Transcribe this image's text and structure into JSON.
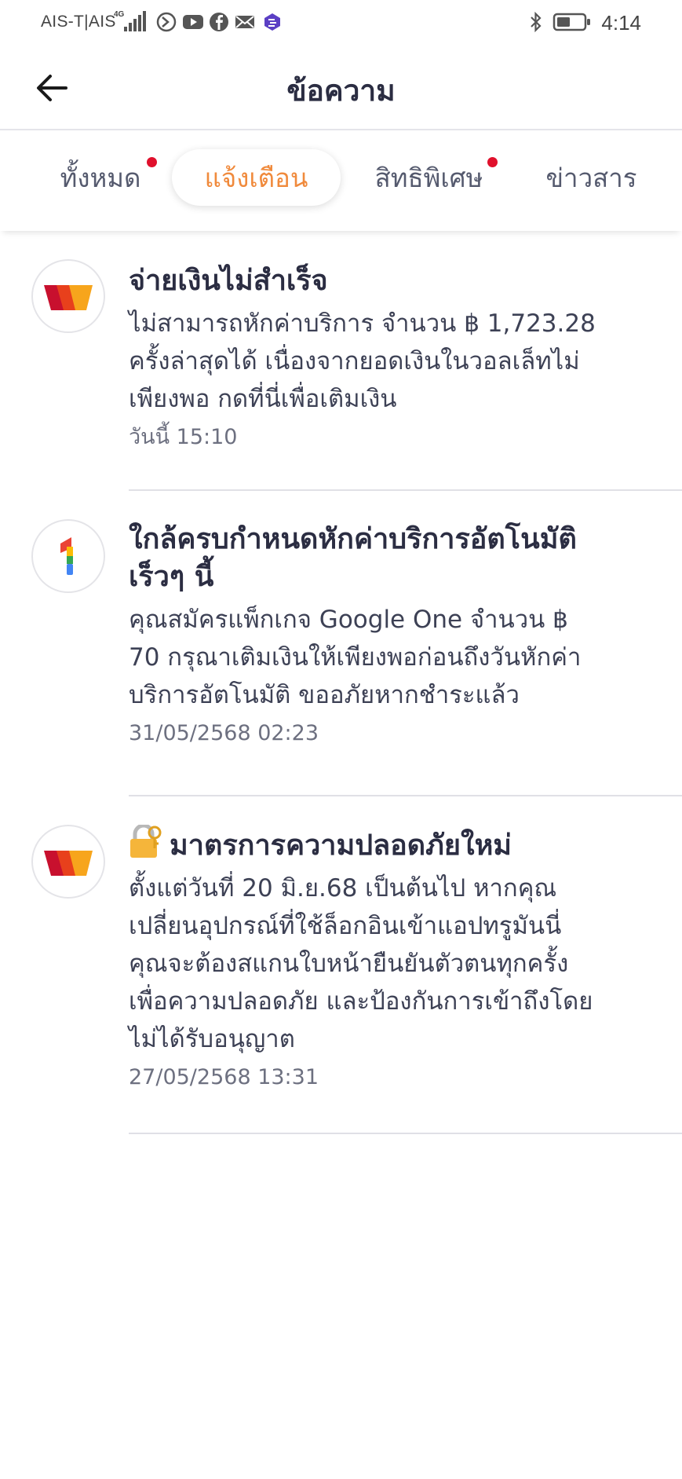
{
  "status_bar": {
    "carrier": "AIS-T|AIS",
    "network": "4G",
    "time": "4:14",
    "icons": [
      "signal-icon",
      "vpn-icon",
      "youtube-icon",
      "facebook-icon",
      "mail-icon",
      "app-icon",
      "bluetooth-icon",
      "battery-icon"
    ]
  },
  "header": {
    "title": "ข้อความ",
    "back_icon": "arrow-left-icon"
  },
  "tabs": [
    {
      "label": "ทั้งหมด",
      "active": false,
      "has_dot": true
    },
    {
      "label": "แจ้งเตือน",
      "active": true,
      "has_dot": false
    },
    {
      "label": "สิทธิพิเศษ",
      "active": false,
      "has_dot": true
    },
    {
      "label": "ข่าวสาร",
      "active": false,
      "has_dot": false
    }
  ],
  "notifications": [
    {
      "icon": "truemoney-wallet-icon",
      "title": "จ่ายเงินไม่สำเร็จ",
      "text_lines": [
        "ไม่สามารถหักค่าบริการ จำนวน ฿ 1,723.28",
        "ครั้งล่าสุดได้ เนื่องจากยอดเงินในวอลเล็ทไม่",
        "เพียงพอ กดที่นี่เพื่อเติมเงิน"
      ],
      "time": "วันนี้ 15:10"
    },
    {
      "icon": "google-one-icon",
      "title_lines": [
        "ใกล้ครบกำหนดหักค่าบริการอัตโนมัติ",
        "เร็วๆ นี้"
      ],
      "text_lines": [
        "คุณสมัครแพ็กเกจ Google One จำนวน ฿",
        "70 กรุณาเติมเงินให้เพียงพอก่อนถึงวันหักค่า",
        "บริการอัตโนมัติ ขออภัยหากชำระแล้ว"
      ],
      "time": "31/05/2568 02:23"
    },
    {
      "icon": "truemoney-wallet-icon",
      "title": "มาตรการความปลอดภัยใหม่",
      "title_icon": "lock-icon",
      "text_lines": [
        "ตั้งแต่วันที่ 20 มิ.ย.68 เป็นต้นไป หากคุณ",
        "เปลี่ยนอุปกรณ์ที่ใช้ล็อกอินเข้าแอปทรูมันนี่",
        "คุณจะต้องสแกนใบหน้ายืนยันตัวตนทุกครั้ง",
        "เพื่อความปลอดภัย และป้องกันการเข้าถึงโดย",
        "ไม่ได้รับอนุญาต"
      ],
      "time": "27/05/2568 13:31"
    }
  ],
  "colors": {
    "accent": "#f08a3c",
    "dot": "#e0102c",
    "title": "#2b2d42",
    "divider": "#e0e0e6"
  }
}
